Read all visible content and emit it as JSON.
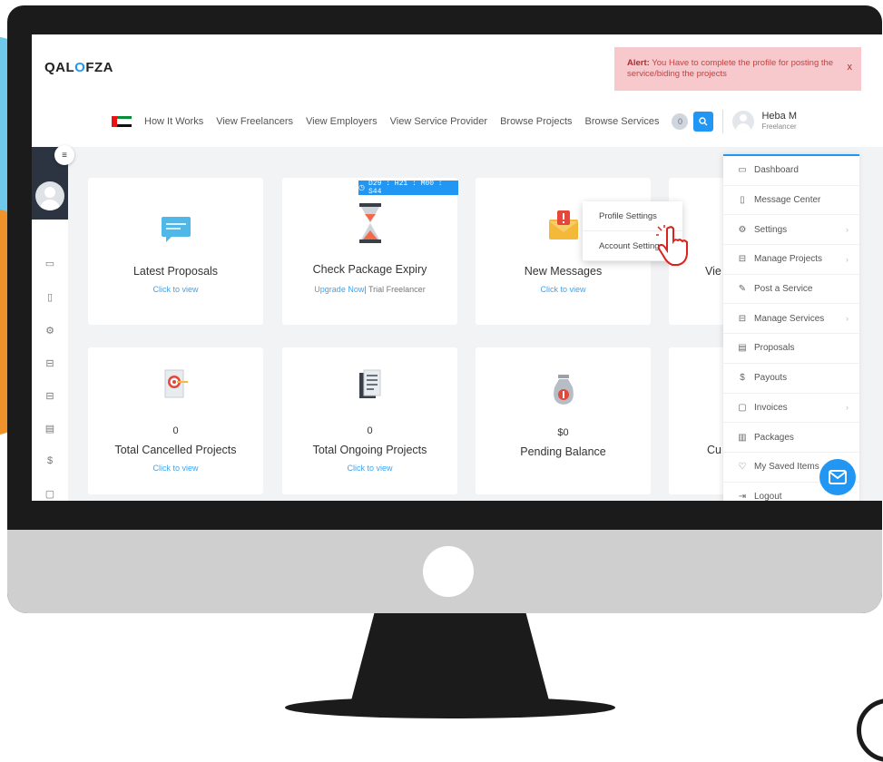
{
  "brand": {
    "logo_q": "Q",
    "logo_rest_1": "AL",
    "logo_o": "O",
    "logo_rest_2": "FZA"
  },
  "alert": {
    "label": "Alert:",
    "message": "You Have to complete the profile for posting the service/biding the projects",
    "close": "x"
  },
  "nav": {
    "links": [
      "How It Works",
      "View Freelancers",
      "View Employers",
      "View Service Provider",
      "Browse Projects",
      "Browse Services"
    ],
    "notif_count": "0"
  },
  "user": {
    "name": "Heba M",
    "role": "Freelancer"
  },
  "timer": "D29 : H21 : M00 : S44",
  "cards": [
    {
      "title": "Latest Proposals",
      "sub": "Click to view"
    },
    {
      "title": "Check Package Expiry",
      "sub_link": "Upgrade Now",
      "sub_rest": "| Trial Freelancer"
    },
    {
      "title": "New Messages",
      "sub": "Click to view"
    },
    {
      "title": "Vie",
      "sub": ""
    },
    {
      "count": "0",
      "title": "Total Cancelled Projects",
      "sub": "Click to view"
    },
    {
      "count": "0",
      "title": "Total Ongoing Projects",
      "sub": "Click to view"
    },
    {
      "count": "$0",
      "title": "Pending Balance",
      "sub": ""
    },
    {
      "count": "",
      "title": "Cu",
      "sub": ""
    }
  ],
  "dropdown": {
    "items": [
      "Profile Settings",
      "Account Settings"
    ]
  },
  "right_menu": {
    "items": [
      {
        "label": "Dashboard",
        "icon": "monitor-icon",
        "glyph": "▭",
        "chev": ""
      },
      {
        "label": "Message Center",
        "icon": "message-icon",
        "glyph": "▯",
        "chev": ""
      },
      {
        "label": "Settings",
        "icon": "gear-icon",
        "glyph": "⚙",
        "chev": "›"
      },
      {
        "label": "Manage Projects",
        "icon": "briefcase-icon",
        "glyph": "⊟",
        "chev": "›"
      },
      {
        "label": "Post a Service",
        "icon": "edit-icon",
        "glyph": "✎",
        "chev": ""
      },
      {
        "label": "Manage Services",
        "icon": "briefcase-icon",
        "glyph": "⊟",
        "chev": "›"
      },
      {
        "label": "Proposals",
        "icon": "document-icon",
        "glyph": "▤",
        "chev": ""
      },
      {
        "label": "Payouts",
        "icon": "dollar-icon",
        "glyph": "$",
        "chev": ""
      },
      {
        "label": "Invoices",
        "icon": "file-icon",
        "glyph": "▢",
        "chev": "›"
      },
      {
        "label": "Packages",
        "icon": "package-icon",
        "glyph": "▥",
        "chev": ""
      },
      {
        "label": "My Saved Items",
        "icon": "heart-icon",
        "glyph": "♡",
        "chev": ""
      },
      {
        "label": "Logout",
        "icon": "logout-icon",
        "glyph": "⇥",
        "chev": ""
      }
    ]
  },
  "sidebar_icons": [
    {
      "icon": "monitor-icon",
      "glyph": "▭"
    },
    {
      "icon": "message-icon",
      "glyph": "▯"
    },
    {
      "icon": "gear-icon",
      "glyph": "⚙"
    },
    {
      "icon": "briefcase-icon",
      "glyph": "⊟"
    },
    {
      "icon": "briefcase-icon",
      "glyph": "⊟"
    },
    {
      "icon": "document-icon",
      "glyph": "▤"
    },
    {
      "icon": "dollar-icon",
      "glyph": "$"
    },
    {
      "icon": "file-icon",
      "glyph": "▢"
    }
  ],
  "colors": {
    "accent": "#2196f3",
    "alert_bg": "#f7c8cc",
    "alert_text": "#c9413f",
    "sidebar_dark": "#2b3440"
  }
}
